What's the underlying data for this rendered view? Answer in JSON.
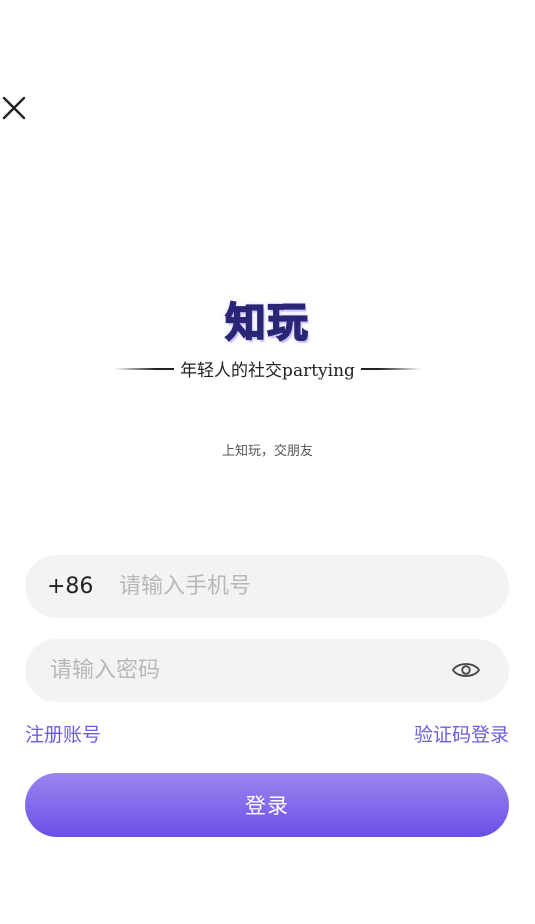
{
  "brand": {
    "logo_text": "知玩",
    "slogan": "年轻人的社交partying",
    "sub_slogan": "上知玩，交朋友"
  },
  "form": {
    "country_code": "+86",
    "phone_placeholder": "请输入手机号",
    "password_placeholder": "请输入密码"
  },
  "links": {
    "register": "注册账号",
    "sms_login": "验证码登录"
  },
  "actions": {
    "login_label": "登录"
  },
  "icons": {
    "close": "close-icon",
    "password_visibility": "eye-icon"
  },
  "colors": {
    "accent": "#6b5ce7",
    "button_gradient_top": "#9b86ee",
    "button_gradient_bottom": "#6b4fe8",
    "field_bg": "#f3f3f3",
    "placeholder": "#b8b8b8"
  }
}
